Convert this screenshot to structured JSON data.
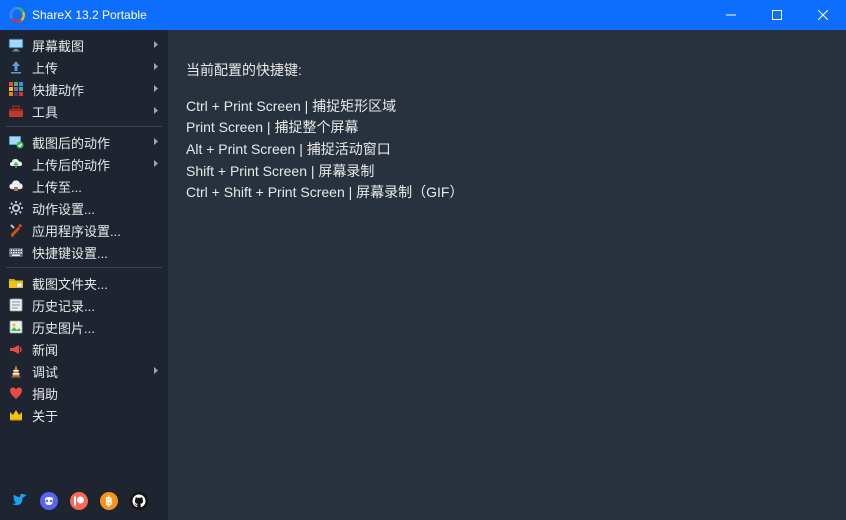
{
  "titlebar": {
    "title": "ShareX 13.2 Portable"
  },
  "sidebar": {
    "groups": [
      [
        {
          "icon": "monitor-icon",
          "label": "屏幕截图",
          "submenu": true
        },
        {
          "icon": "upload-icon",
          "label": "上传",
          "submenu": true
        },
        {
          "icon": "grid-icon",
          "label": "快捷动作",
          "submenu": true
        },
        {
          "icon": "toolbox-icon",
          "label": "工具",
          "submenu": true
        }
      ],
      [
        {
          "icon": "after-capture-icon",
          "label": "截图后的动作",
          "submenu": true
        },
        {
          "icon": "after-upload-icon",
          "label": "上传后的动作",
          "submenu": true
        },
        {
          "icon": "dest-icon",
          "label": "上传至...",
          "submenu": false
        },
        {
          "icon": "gear-icon",
          "label": "动作设置...",
          "submenu": false
        },
        {
          "icon": "wrench-icon",
          "label": "应用程序设置...",
          "submenu": false
        },
        {
          "icon": "keyboard-icon",
          "label": "快捷键设置...",
          "submenu": false
        }
      ],
      [
        {
          "icon": "folder-icon",
          "label": "截图文件夹...",
          "submenu": false
        },
        {
          "icon": "history-icon",
          "label": "历史记录...",
          "submenu": false
        },
        {
          "icon": "image-history-icon",
          "label": "历史图片...",
          "submenu": false
        },
        {
          "icon": "megaphone-icon",
          "label": "新闻",
          "submenu": false
        },
        {
          "icon": "cone-icon",
          "label": "调试",
          "submenu": true
        },
        {
          "icon": "heart-icon",
          "label": "捐助",
          "submenu": false
        },
        {
          "icon": "crown-icon",
          "label": "关于",
          "submenu": false
        }
      ]
    ]
  },
  "bottom_icons": [
    "twitter-icon",
    "discord-icon",
    "patreon-icon",
    "bitcoin-icon",
    "github-icon"
  ],
  "main": {
    "heading": "当前配置的快捷键:",
    "lines": [
      "Ctrl + Print Screen  |  捕捉矩形区域",
      "Print Screen  |  捕捉整个屏幕",
      "Alt + Print Screen  |  捕捉活动窗口",
      "Shift + Print Screen  |  屏幕录制",
      "Ctrl + Shift + Print Screen  |  屏幕录制（GIF）"
    ]
  }
}
